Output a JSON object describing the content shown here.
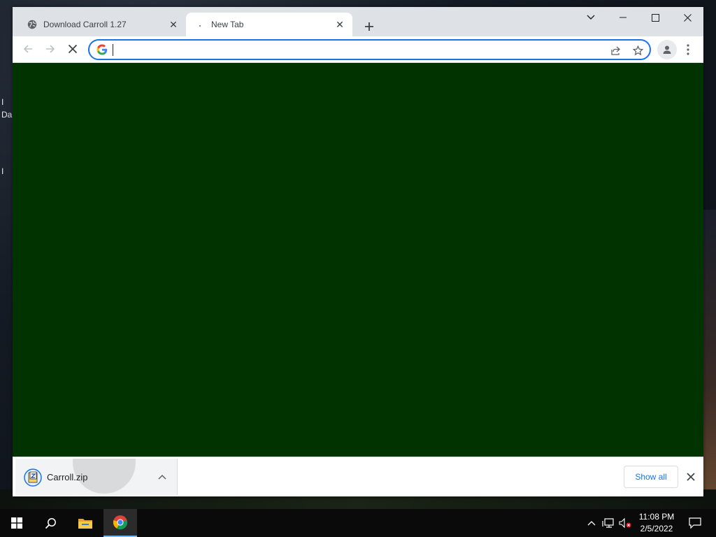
{
  "browser": {
    "tabs": [
      {
        "title": "Download Carroll 1.27",
        "icon": "globe-icon",
        "active": false
      },
      {
        "title": "New Tab",
        "icon": "loading-icon",
        "active": true
      }
    ],
    "new_tab_icon": "plus-icon",
    "window_controls": [
      "chevron-down-icon",
      "minimize-icon",
      "maximize-icon",
      "close-icon"
    ],
    "toolbar": {
      "back_icon": "back-arrow-icon",
      "forward_icon": "forward-arrow-icon",
      "stop_icon": "stop-loading-icon",
      "address": {
        "value": "",
        "engine_icon": "google-g-icon"
      },
      "share_icon": "share-icon",
      "bookmark_icon": "star-icon",
      "profile_icon": "profile-icon",
      "menu_icon": "kebab-menu-icon"
    },
    "content_bg": "#003300",
    "download_shelf": {
      "items": [
        {
          "filename": "Carroll.zip",
          "icon": "zip-file-icon"
        }
      ],
      "show_all_label": "Show all",
      "close_icon": "close-icon"
    }
  },
  "desktop": {
    "fragments": [
      "I",
      "Da",
      "I"
    ]
  },
  "taskbar": {
    "start_icon": "windows-start-icon",
    "search_icon": "search-icon",
    "pinned": [
      "file-explorer-icon",
      "chrome-icon"
    ],
    "tray": [
      "chevron-up-icon",
      "network-icon",
      "volume-muted-icon"
    ],
    "clock": {
      "time": "11:08 PM",
      "date": "2/5/2022"
    },
    "notifications_icon": "notification-icon"
  }
}
